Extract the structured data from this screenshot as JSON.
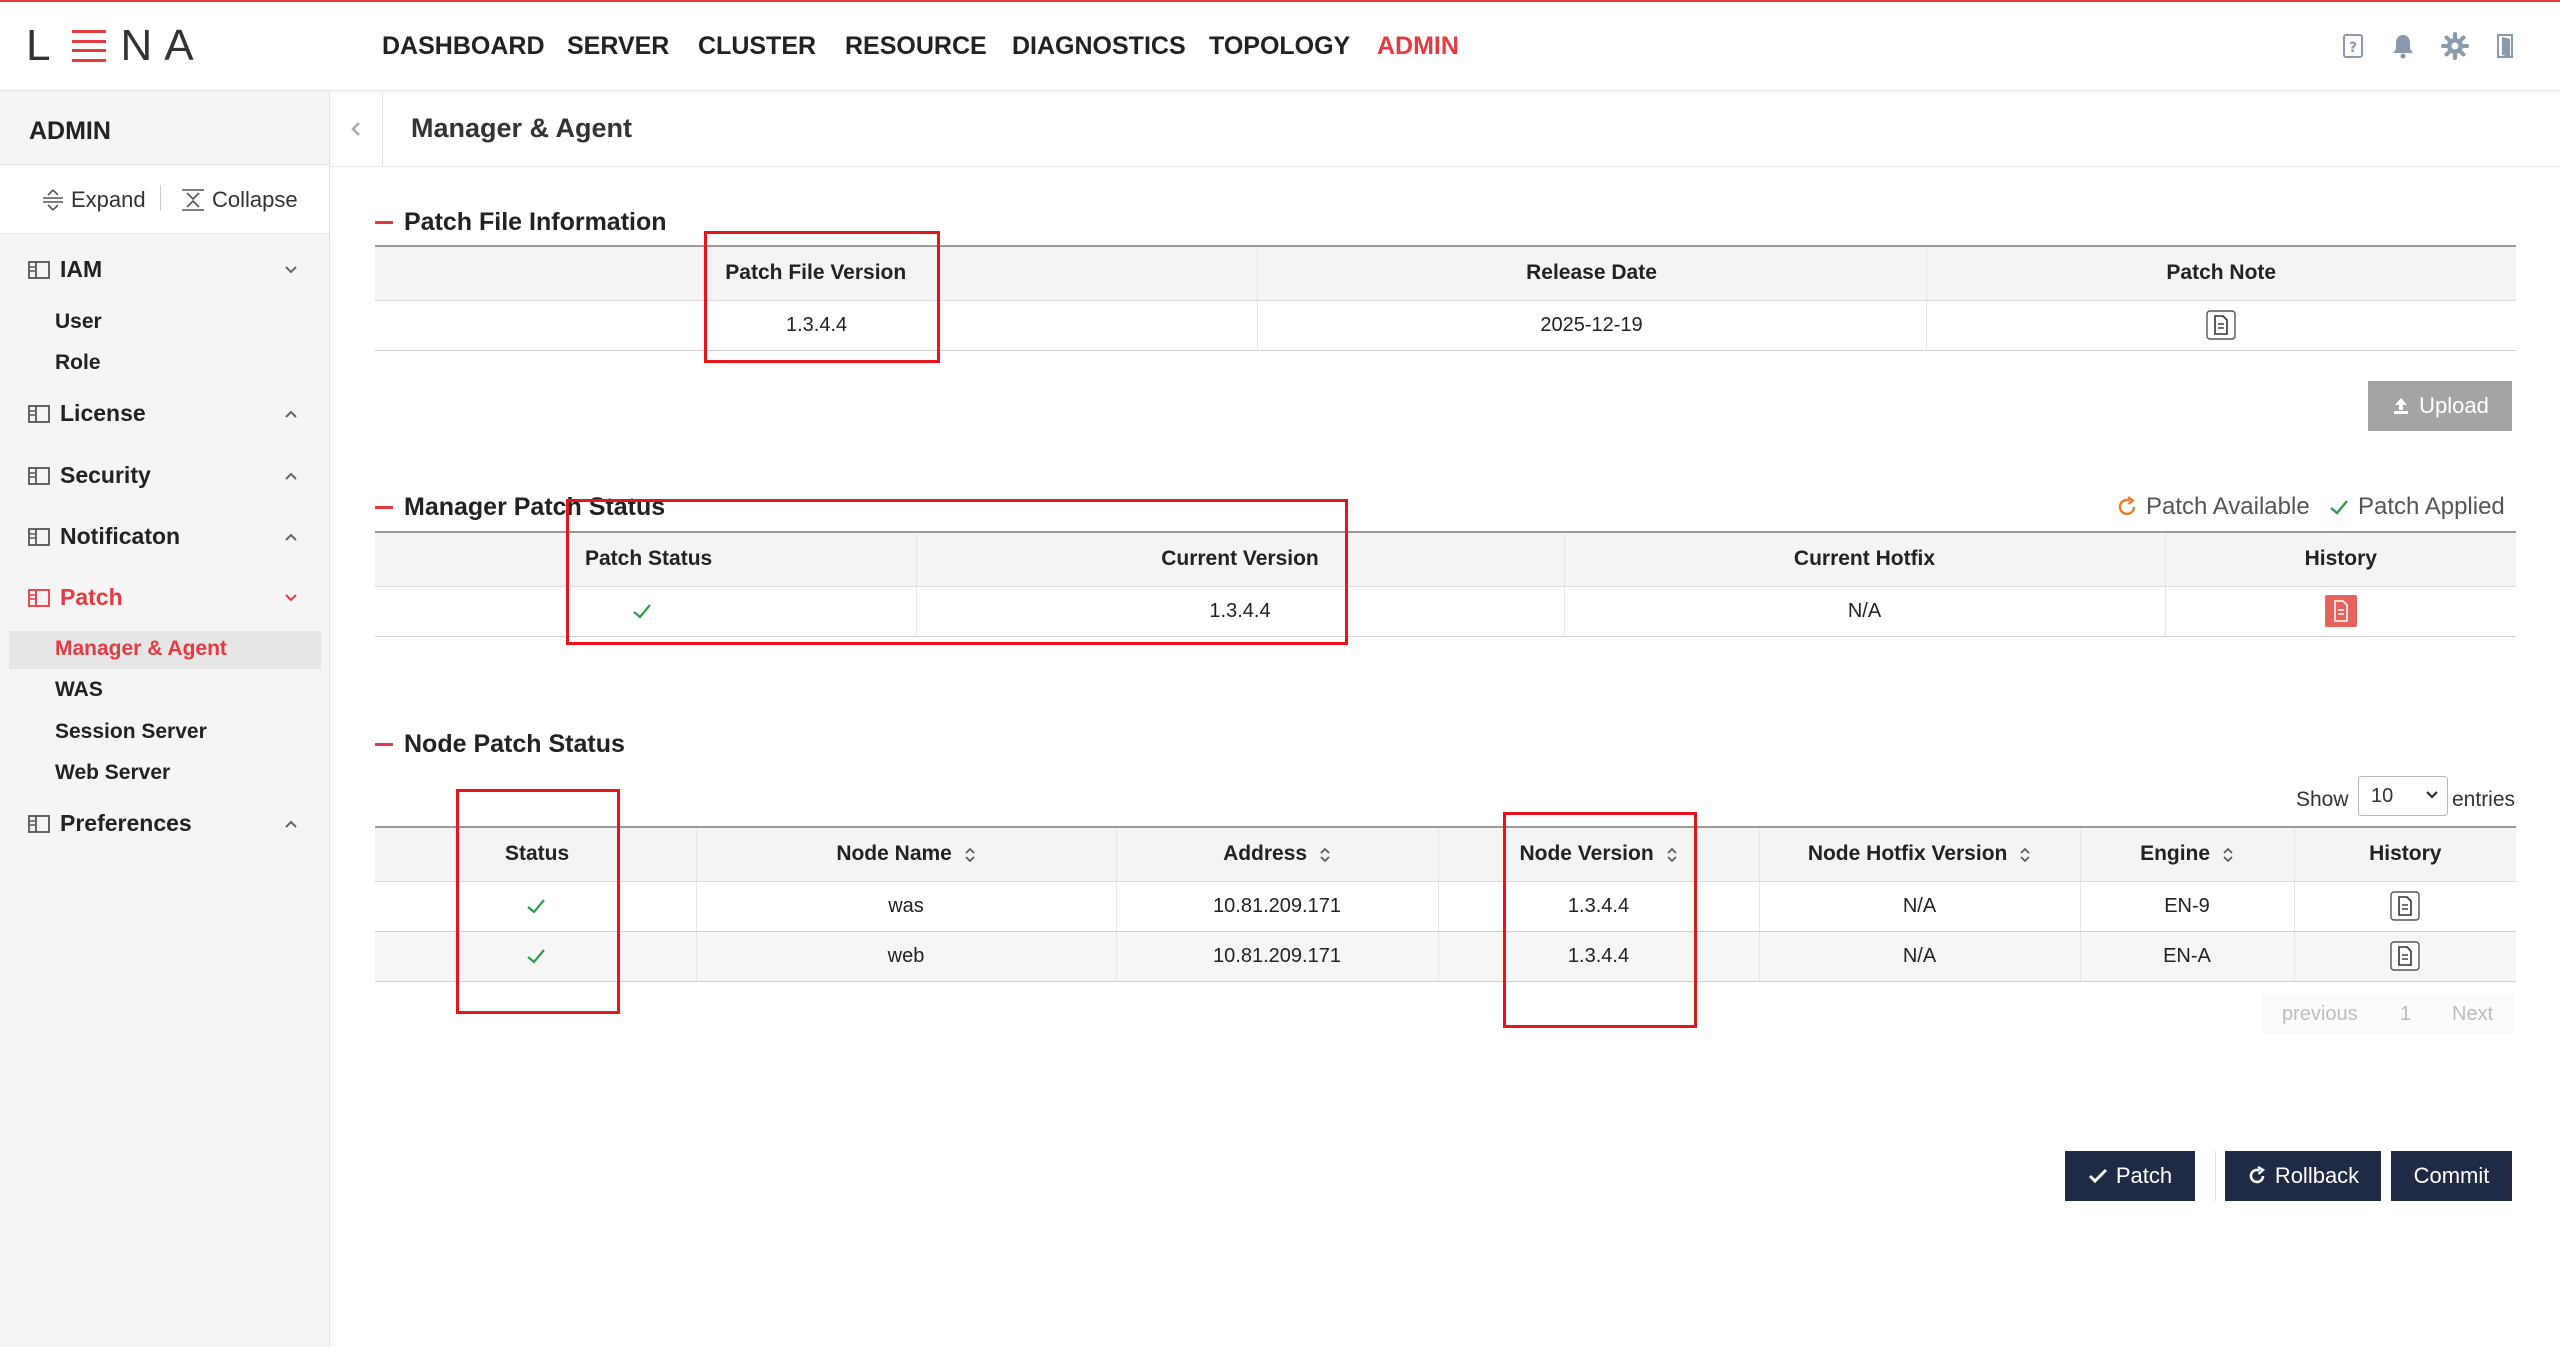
{
  "app": {
    "logo_left": "L",
    "logo_right": "NA"
  },
  "nav": {
    "items": [
      "DASHBOARD",
      "SERVER",
      "CLUSTER",
      "RESOURCE",
      "DIAGNOSTICS",
      "TOPOLOGY",
      "ADMIN"
    ],
    "active": "ADMIN"
  },
  "top_icons": [
    "help-icon",
    "bell-icon",
    "gear-icon",
    "logout-icon"
  ],
  "sidebar": {
    "title": "ADMIN",
    "expand": "Expand",
    "collapse": "Collapse",
    "groups": {
      "iam": {
        "label": "IAM",
        "items": [
          "User",
          "Role"
        ]
      },
      "license": {
        "label": "License"
      },
      "security": {
        "label": "Security"
      },
      "notification": {
        "label": "Notificaton"
      },
      "patch": {
        "label": "Patch",
        "items": [
          "Manager & Agent",
          "WAS",
          "Session Server",
          "Web Server"
        ],
        "selected": "Manager & Agent"
      },
      "preferences": {
        "label": "Preferences"
      }
    }
  },
  "page": {
    "title": "Manager & Agent"
  },
  "patch_file": {
    "title": "Patch File Information",
    "headers": [
      "Patch File Version",
      "Release Date",
      "Patch Note"
    ],
    "row": {
      "version": "1.3.4.4",
      "release_date": "2025-12-19"
    },
    "upload_label": "Upload"
  },
  "manager_status": {
    "title": "Manager Patch Status",
    "legend": {
      "available": "Patch Available",
      "applied": "Patch Applied"
    },
    "headers": [
      "Patch Status",
      "Current Version",
      "Current Hotfix",
      "History"
    ],
    "row": {
      "status": "applied",
      "current_version": "1.3.4.4",
      "current_hotfix": "N/A"
    }
  },
  "node_status": {
    "title": "Node Patch Status",
    "show": "Show",
    "entries": "entries",
    "page_size": "10",
    "headers": [
      "Status",
      "Node Name",
      "Address",
      "Node Version",
      "Node Hotfix Version",
      "Engine",
      "History"
    ],
    "rows": [
      {
        "status": "applied",
        "name": "was",
        "address": "10.81.209.171",
        "version": "1.3.4.4",
        "hotfix": "N/A",
        "engine": "EN-9"
      },
      {
        "status": "applied",
        "name": "web",
        "address": "10.81.209.171",
        "version": "1.3.4.4",
        "hotfix": "N/A",
        "engine": "EN-A"
      }
    ],
    "pagination": {
      "previous": "previous",
      "page": "1",
      "next": "Next"
    }
  },
  "actions": {
    "patch": "Patch",
    "rollback": "Rollback",
    "commit": "Commit"
  },
  "colors": {
    "accent": "#e53a40",
    "success": "#2e9d4a",
    "dark_button": "#1f2a44",
    "annotation": "#e8141c"
  }
}
